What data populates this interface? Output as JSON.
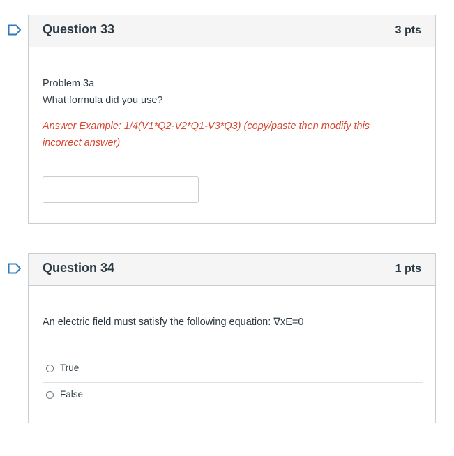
{
  "questions": [
    {
      "flag_icon": "flag-outline-icon",
      "title": "Question 33",
      "points": "3 pts",
      "lines": [
        "Problem 3a",
        "What formula did you use?"
      ],
      "note_line1": "Answer Example: 1/4(V1*Q2-V2*Q1-V3*Q3) (copy/paste then modify this",
      "note_line2": "incorrect answer)",
      "input_value": "",
      "input_placeholder": ""
    },
    {
      "flag_icon": "flag-outline-icon",
      "title": "Question 34",
      "points": "1 pts",
      "text": "An electric field must satisfy the following equation: ∇xE=0",
      "answers": [
        "True",
        "False"
      ]
    }
  ],
  "colors": {
    "flag": "#2b7abc",
    "note": "#d9452f",
    "header_bg": "#f5f5f5",
    "border": "#c7cdd1"
  }
}
